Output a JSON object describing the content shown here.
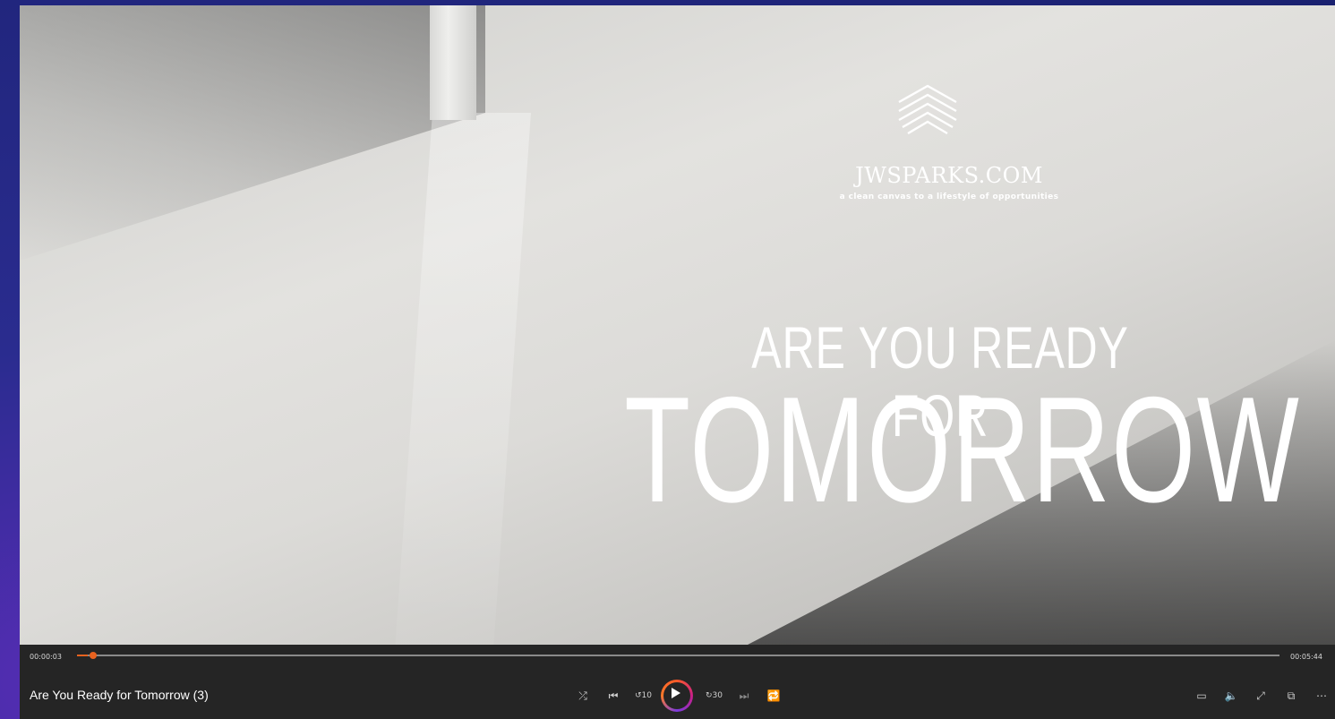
{
  "video": {
    "brand": "JWSPARKS.COM",
    "tagline": "a clean canvas to a lifestyle of opportunities",
    "headline_line1": "ARE YOU READY FOR",
    "headline_line2": "TOMORROW"
  },
  "player": {
    "elapsed": "00:00:03",
    "duration": "00:05:44",
    "progress_fraction": 0.009,
    "title": "Are You Ready for Tomorrow (3)",
    "accent_color": "#e8621f"
  },
  "controls": {
    "center": [
      "shuffle-icon",
      "previous-icon",
      "skip-back-10-icon",
      "play-icon",
      "skip-forward-30-icon",
      "next-icon",
      "repeat-off-icon"
    ],
    "right": [
      "captions-icon",
      "volume-icon",
      "fullscreen-icon",
      "mini-player-icon",
      "more-icon"
    ],
    "skip_back_label": "10",
    "skip_forward_label": "30"
  }
}
